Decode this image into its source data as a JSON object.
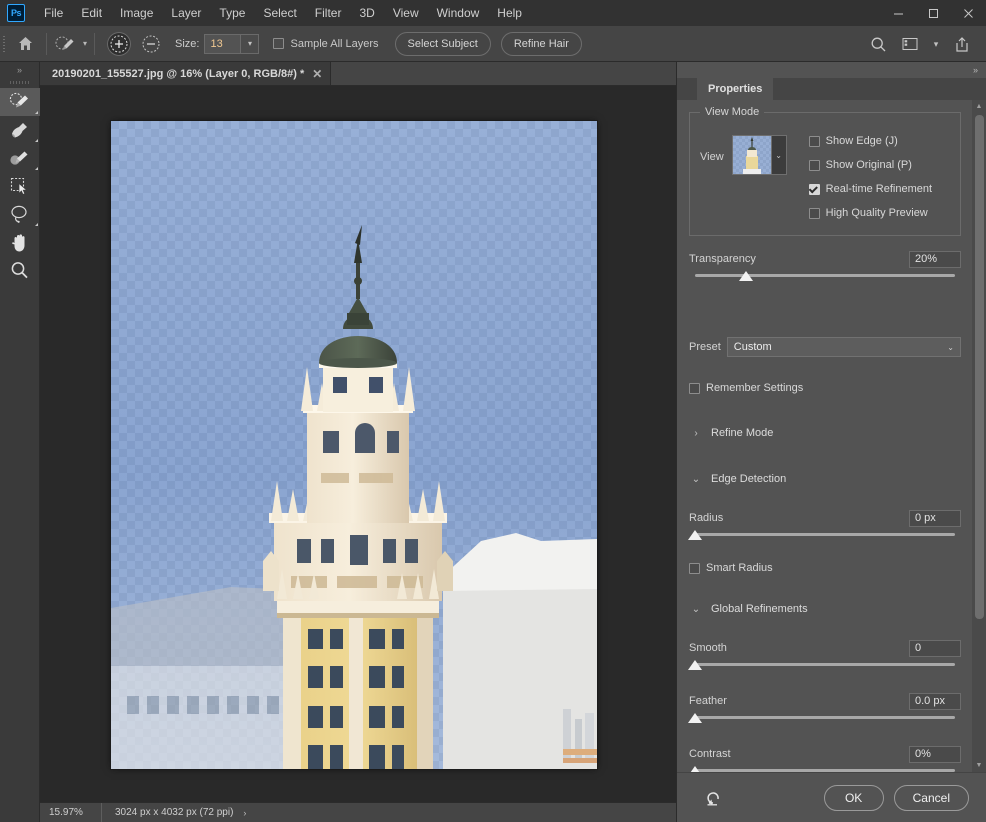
{
  "window": {
    "app_logo": "Ps",
    "controls": {
      "minimize": "–",
      "maximize": "□",
      "close": "✕"
    }
  },
  "menubar": {
    "items": [
      "File",
      "Edit",
      "Image",
      "Layer",
      "Type",
      "Select",
      "Filter",
      "3D",
      "View",
      "Window",
      "Help"
    ]
  },
  "options_bar": {
    "home_icon": "home-icon",
    "brush_preset_icon": "brush-preset-icon",
    "add_label": "+",
    "subtract_label": "−",
    "size_label": "Size:",
    "size_value": "13",
    "sample_all_layers_label": "Sample All Layers",
    "sample_all_layers_checked": false,
    "select_subject_label": "Select Subject",
    "refine_hair_label": "Refine Hair",
    "search_icon": "search-icon",
    "workspace_icon": "workspace-switcher-icon",
    "share_icon": "share-icon"
  },
  "toolbar": {
    "collapse_label": "»",
    "tools": [
      {
        "name": "quick-selection-tool",
        "active": true,
        "has_corner": true
      },
      {
        "name": "history-brush-tool",
        "active": false,
        "has_corner": true
      },
      {
        "name": "blur-tool",
        "active": false,
        "has_corner": true
      },
      {
        "name": "move-tool",
        "active": false,
        "has_corner": false
      },
      {
        "name": "lasso-tool",
        "active": false,
        "has_corner": true
      },
      {
        "name": "hand-tool",
        "active": false,
        "has_corner": false
      },
      {
        "name": "zoom-tool",
        "active": false,
        "has_corner": false
      }
    ]
  },
  "document": {
    "tab_title": "20190201_155527.jpg @ 16% (Layer 0, RGB/8#) *",
    "close_glyph": "✕"
  },
  "statusbar": {
    "zoom": "15.97%",
    "dimensions": "3024 px x 4032 px (72 ppi)",
    "arrow": "›"
  },
  "panel": {
    "collapse_glyph": "»",
    "tab_label": "Properties",
    "view_mode": {
      "legend": "View Mode",
      "view_label": "View",
      "thumb_chevron": "⌄",
      "options": [
        {
          "label": "Show Edge (J)",
          "checked": false
        },
        {
          "label": "Show Original (P)",
          "checked": false
        },
        {
          "label": "Real-time Refinement",
          "checked": true
        },
        {
          "label": "High Quality Preview",
          "checked": false
        }
      ]
    },
    "transparency": {
      "label": "Transparency",
      "value": "20%",
      "percent": 20
    },
    "preset": {
      "label": "Preset",
      "value": "Custom",
      "chevron": "⌄"
    },
    "remember_settings": {
      "label": "Remember Settings",
      "checked": false
    },
    "refine_mode": {
      "label": "Refine Mode",
      "triangle": "›",
      "expanded": false
    },
    "edge_detection": {
      "label": "Edge Detection",
      "triangle": "⌄",
      "expanded": true,
      "radius": {
        "label": "Radius",
        "value": "0 px",
        "percent": 0
      },
      "smart_radius": {
        "label": "Smart Radius",
        "checked": false
      }
    },
    "global_refinements": {
      "label": "Global Refinements",
      "triangle": "⌄",
      "expanded": true,
      "sliders": [
        {
          "label": "Smooth",
          "value": "0",
          "percent": 0
        },
        {
          "label": "Feather",
          "value": "0.0 px",
          "percent": 0
        },
        {
          "label": "Contrast",
          "value": "0%",
          "percent": 0
        }
      ]
    },
    "footer": {
      "reset_icon": "reset-icon",
      "ok_label": "OK",
      "cancel_label": "Cancel"
    }
  },
  "colors": {
    "app_background": "#323232",
    "panel_background": "#535353",
    "options_bar": "#454545",
    "canvas_background": "#292929",
    "accent_blue": "#31a8ff",
    "value_text": "#f0c891",
    "sky_blue": "#6f8dc0"
  }
}
